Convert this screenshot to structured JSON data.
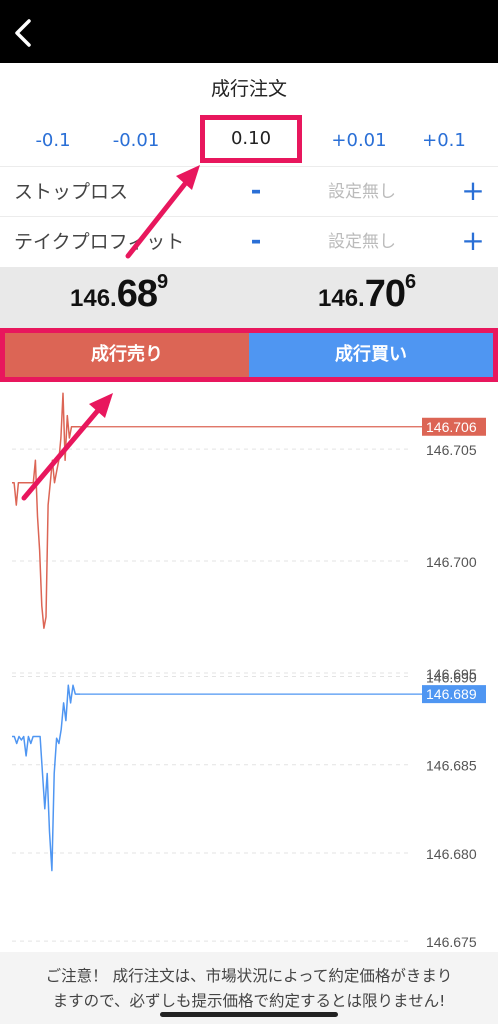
{
  "header": {
    "back_icon": "chevron-left-icon"
  },
  "order": {
    "title": "成行注文",
    "lot_steps": [
      "-0.1",
      "-0.01",
      "+0.01",
      "+0.1"
    ],
    "lot_value": "0.10",
    "stop_loss": {
      "label": "ストップロス",
      "minus": "-",
      "value": "設定無し",
      "plus": "+"
    },
    "take_profit": {
      "label": "テイクプロフィット",
      "minus": "-",
      "value": "設定無し",
      "plus": "+"
    }
  },
  "prices": {
    "bid": {
      "small": "146.",
      "big": "68",
      "sup": "9"
    },
    "ask": {
      "small": "146.",
      "big": "70",
      "sup": "6"
    }
  },
  "buttons": {
    "sell": "成行売り",
    "buy": "成行買い"
  },
  "colors": {
    "sell": "#dc6555",
    "buy": "#4f96f2",
    "highlight": "#e8175d",
    "header": "#000000"
  },
  "chart_data": [
    {
      "type": "line",
      "series": [
        {
          "values": [
            146.7035,
            146.7035,
            146.7025,
            146.7035,
            146.7035,
            146.7035,
            146.7035,
            146.7035,
            146.7035,
            146.7035,
            146.7035,
            146.7045,
            146.702,
            146.7005,
            146.698,
            146.697,
            146.6975,
            146.7025,
            146.7035,
            146.7045,
            146.7035,
            146.704,
            146.7045,
            146.7055,
            146.7075,
            146.7045,
            146.7065,
            146.7055,
            146.706,
            146.706,
            146.706,
            146.706,
            146.706
          ]
        }
      ],
      "ylim": [
        146.6975,
        146.708
      ],
      "yticks": [
        "146.705",
        "146.700",
        "146.695"
      ],
      "last_price": "146.706",
      "grid": true
    },
    {
      "type": "line",
      "series": [
        {
          "values": [
            146.6866,
            146.6866,
            146.6862,
            146.6866,
            146.6864,
            146.6866,
            146.6855,
            146.6866,
            146.6862,
            146.6866,
            146.6866,
            146.6866,
            146.6866,
            146.6845,
            146.6825,
            146.6845,
            146.6812,
            146.679,
            146.6845,
            146.6865,
            146.6862,
            146.687,
            146.6885,
            146.6875,
            146.6895,
            146.6885,
            146.6895,
            146.689,
            146.689,
            146.689
          ]
        }
      ],
      "ylim": [
        146.6745,
        146.6915
      ],
      "yticks": [
        "146.690",
        "146.685",
        "146.680",
        "146.675"
      ],
      "last_price": "146.689",
      "grid": true
    }
  ],
  "notice": {
    "line1": "ご注意！ 成行注文は、市場状況によって約定価格がきまり",
    "line2": "ますので、必ずしも提示価格で約定するとは限りません!"
  }
}
